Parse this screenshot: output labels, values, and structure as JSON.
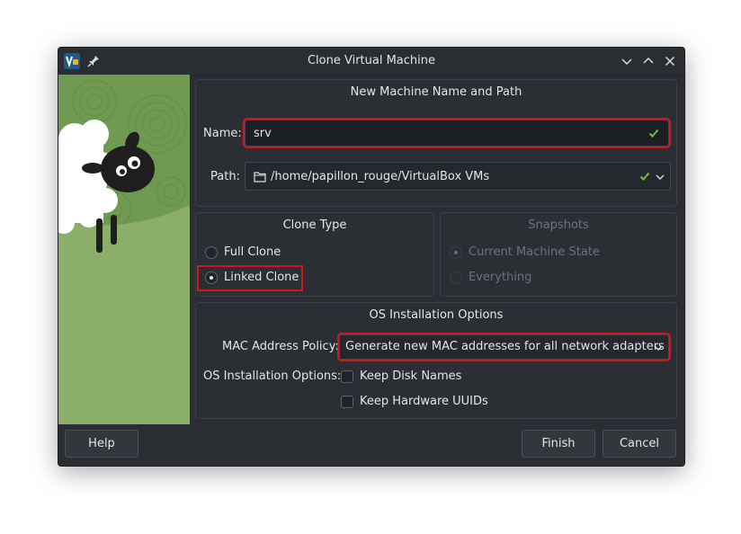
{
  "window": {
    "title": "Clone Virtual Machine"
  },
  "titlebar": {
    "app_icon": "virtualbox-icon",
    "pin_icon": "pin-icon",
    "controls": [
      "minimize-icon",
      "maximize-icon",
      "close-icon"
    ]
  },
  "name_path": {
    "title": "New Machine Name and Path",
    "name_label": "Name:",
    "name_value": "srv",
    "path_label": "Path:",
    "path_value": "/home/papillon_rouge/VirtualBox VMs"
  },
  "clone_type": {
    "title": "Clone Type",
    "options": [
      {
        "label": "Full Clone",
        "selected": false
      },
      {
        "label": "Linked Clone",
        "selected": true
      }
    ]
  },
  "snapshots": {
    "title": "Snapshots",
    "enabled": false,
    "options": [
      {
        "label": "Current Machine State",
        "selected": true
      },
      {
        "label": "Everything",
        "selected": false
      }
    ]
  },
  "os_options": {
    "title": "OS Installation Options",
    "mac_label": "MAC Address Policy:",
    "mac_value": "Generate new MAC addresses for all network adapters",
    "options_label": "OS Installation Options:",
    "checkboxes": [
      {
        "label": "Keep Disk Names",
        "checked": false
      },
      {
        "label": "Keep Hardware UUIDs",
        "checked": false
      }
    ]
  },
  "buttons": {
    "help": "Help",
    "finish": "Finish",
    "cancel": "Cancel"
  },
  "colors": {
    "window_bg": "#2a2e32",
    "field_bg": "#1c1f23",
    "highlight": "#d0191c",
    "valid": "#6ebe30",
    "wizard_green": "#8bb06a"
  }
}
